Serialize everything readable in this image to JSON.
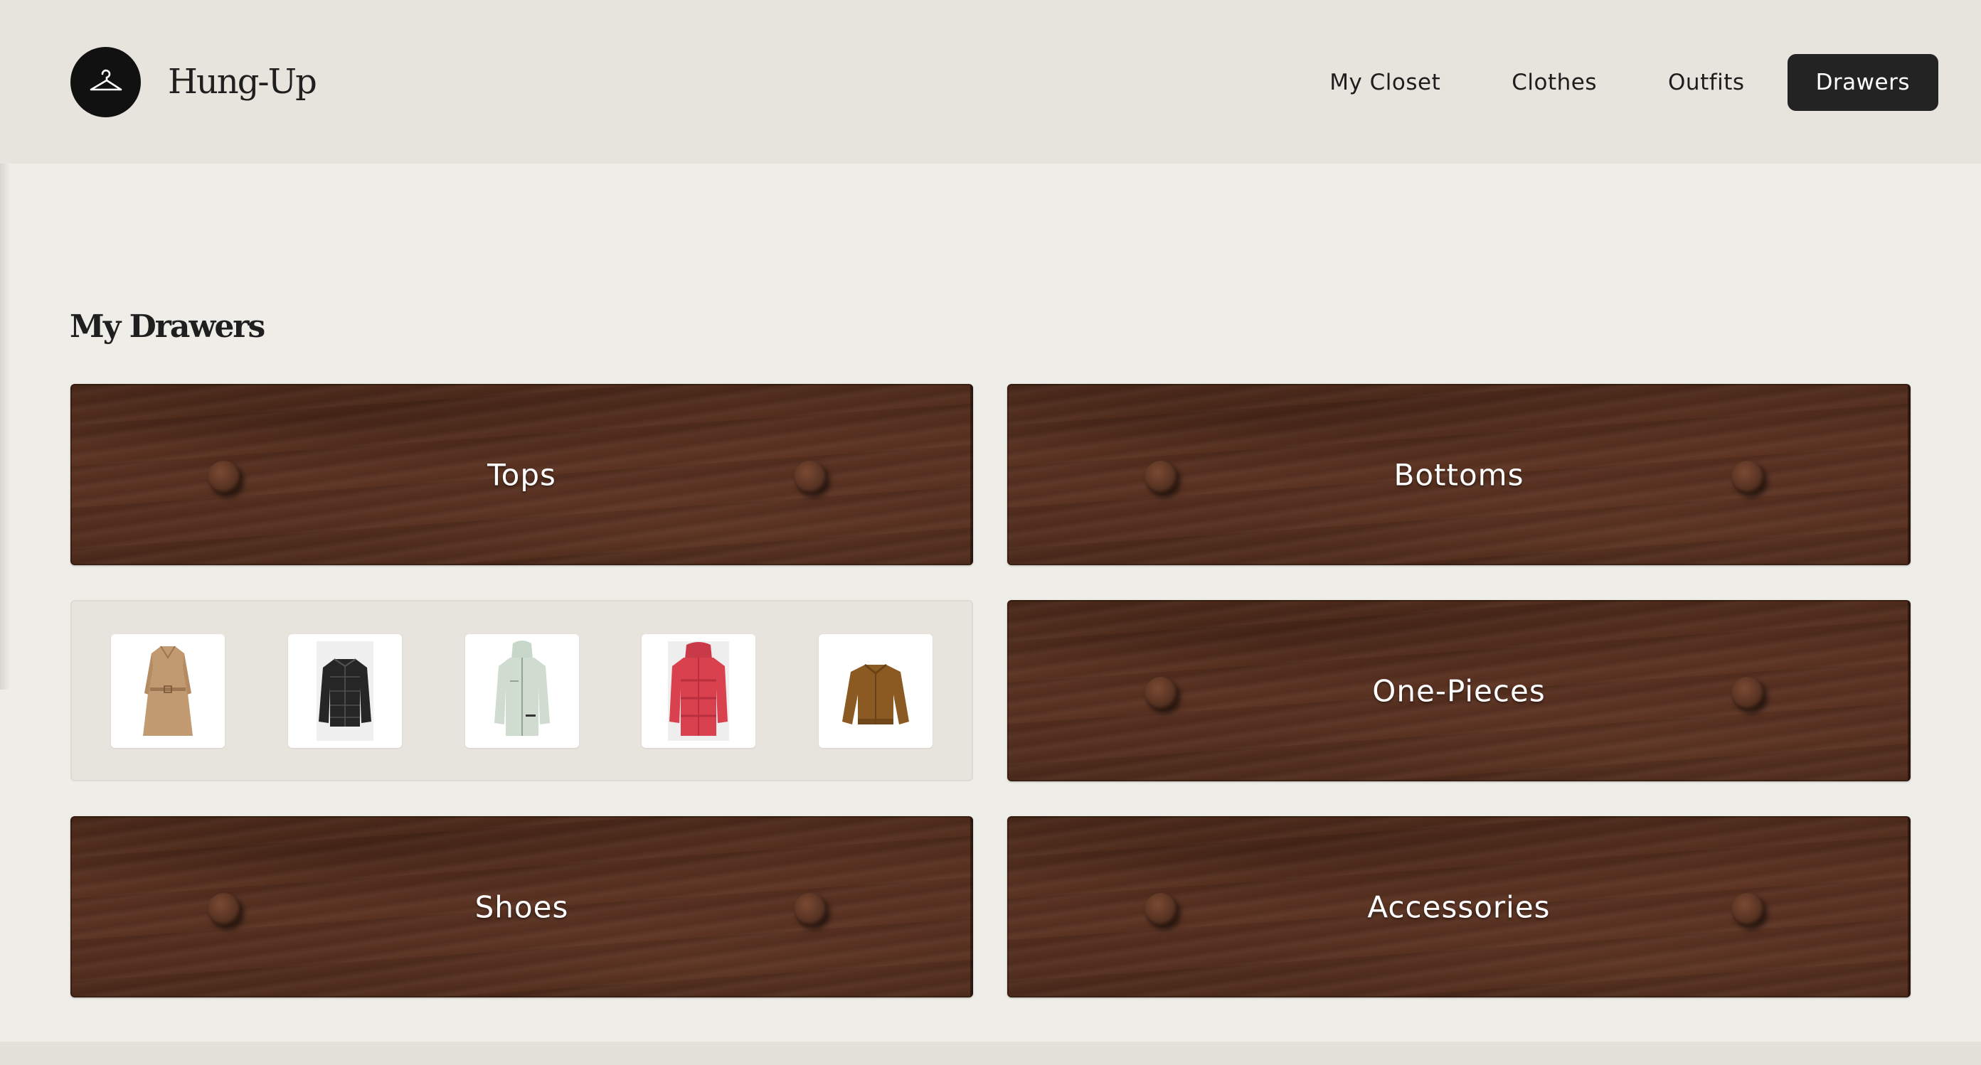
{
  "app": {
    "brand": "Hung-Up",
    "logo_icon": "hanger-icon"
  },
  "nav": {
    "items": [
      {
        "label": "My Closet",
        "active": false
      },
      {
        "label": "Clothes",
        "active": false
      },
      {
        "label": "Outfits",
        "active": false
      },
      {
        "label": "Drawers",
        "active": true
      }
    ]
  },
  "main": {
    "title": "My Drawers",
    "drawers": [
      {
        "label": "Tops",
        "open": false
      },
      {
        "label": "Bottoms",
        "open": false
      },
      {
        "label": "One-Pieces",
        "open": false
      },
      {
        "label": "Shoes",
        "open": false
      },
      {
        "label": "Accessories",
        "open": false
      }
    ],
    "open_drawer": {
      "items": [
        {
          "icon": "camel-trench-coat-icon"
        },
        {
          "icon": "black-puffer-jacket-icon"
        },
        {
          "icon": "mint-hooded-jacket-icon"
        },
        {
          "icon": "red-puffer-jacket-icon"
        },
        {
          "icon": "brown-bomber-jacket-icon"
        }
      ]
    }
  },
  "colors": {
    "header_bg": "#e7e4dd",
    "page_bg": "#efede8",
    "active_nav_bg": "#232323",
    "wood": "#5a3222"
  }
}
